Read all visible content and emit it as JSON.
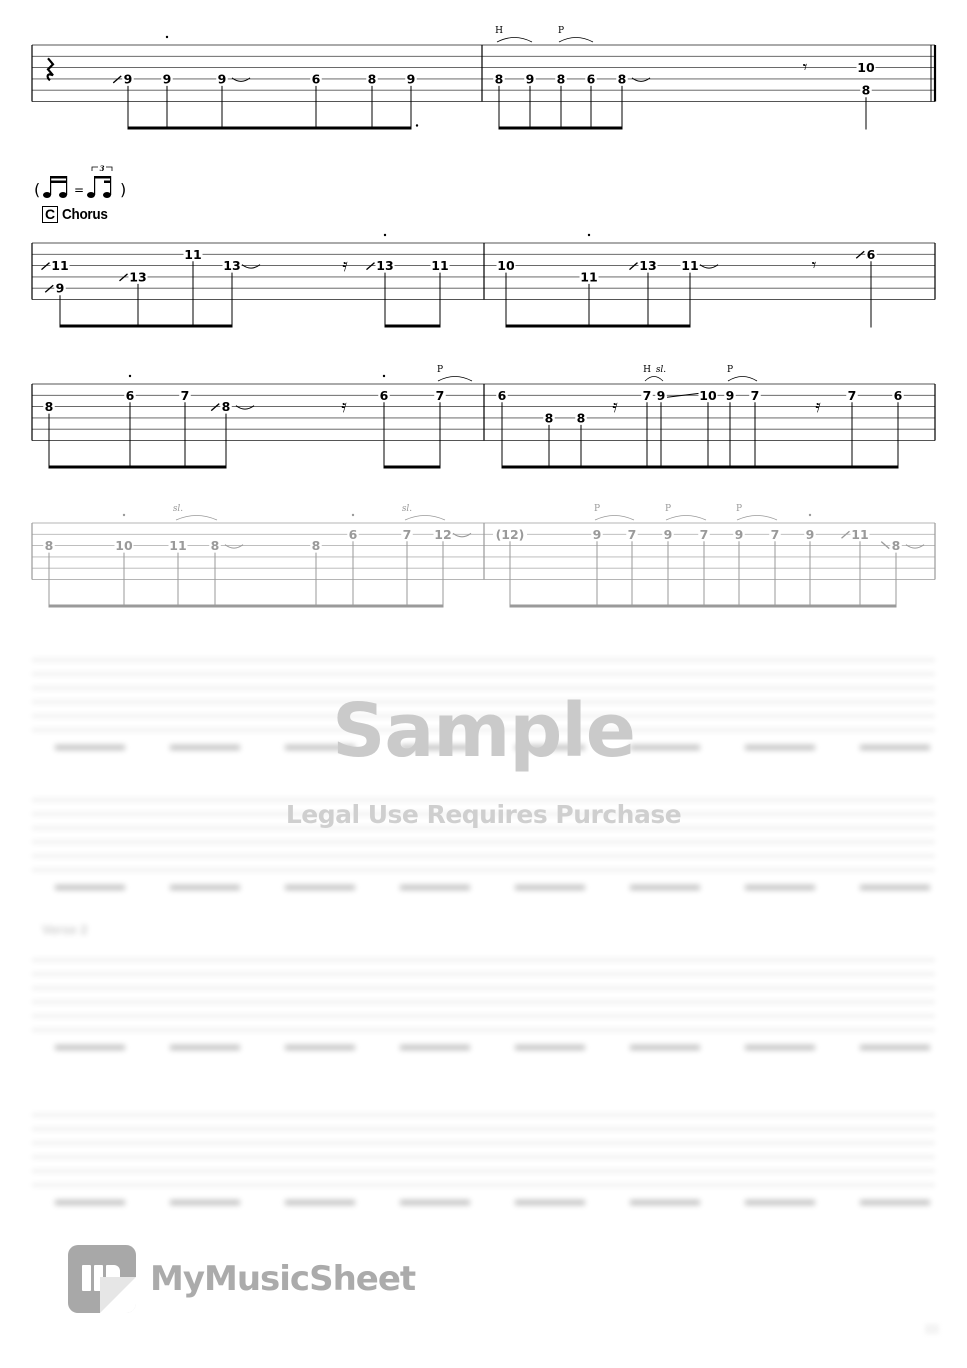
{
  "page": {
    "watermark": {
      "title": "Sample",
      "subtitle": "Legal Use Requires Purchase"
    },
    "brand": {
      "name": "MyMusicSheet"
    },
    "section_marker": {
      "letter": "C",
      "name": "Chorus"
    },
    "swing_note": {
      "left": "(",
      "equals": "=",
      "tuplet": "3",
      "right": ")"
    },
    "blurred_section_label": "Verse 2",
    "colors": {
      "ink": "#000000",
      "faded_ink": "#9a9a9a",
      "watermark": "#cacaca",
      "logo": "#a8a8a8"
    }
  },
  "systems": [
    {
      "id": "system-1",
      "faded": false,
      "end_barline": "double",
      "measures": [
        {
          "notes": [
            {
              "rest": "quarter"
            },
            {
              "string": 4,
              "fret": "9",
              "slide_in": "up",
              "beam": "16-8"
            },
            {
              "string": 4,
              "fret": "9",
              "dot_above": true
            },
            {
              "string": 4,
              "fret": "9",
              "tie_out": true
            },
            {
              "string": 4,
              "fret": "6"
            },
            {
              "string": 4,
              "fret": "8"
            },
            {
              "string": 4,
              "fret": "9",
              "dotted": true
            }
          ]
        },
        {
          "notes": [
            {
              "string": 4,
              "fret": "8",
              "technique": "H"
            },
            {
              "string": 4,
              "fret": "9"
            },
            {
              "string": 4,
              "fret": "8",
              "technique": "P"
            },
            {
              "string": 4,
              "fret": "6"
            },
            {
              "string": 4,
              "fret": "8",
              "tie_out": true
            },
            {
              "rest": "eighth"
            },
            {
              "chord": [
                {
                  "string": 3,
                  "fret": "10"
                },
                {
                  "string": 5,
                  "fret": "8"
                }
              ]
            }
          ]
        }
      ]
    },
    {
      "id": "system-2",
      "faded": false,
      "end_barline": "single",
      "measures": [
        {
          "notes": [
            {
              "chord": [
                {
                  "string": 3,
                  "fret": "11",
                  "slide_in": "up"
                },
                {
                  "string": 5,
                  "fret": "9",
                  "slide_in": "up"
                }
              ]
            },
            {
              "string": 4,
              "fret": "13",
              "slide_in": "up"
            },
            {
              "string": 2,
              "fret": "11"
            },
            {
              "string": 3,
              "fret": "13",
              "tie_out": true
            },
            {
              "rest": "sixteenth"
            },
            {
              "string": 3,
              "fret": "13",
              "slide_in": "up",
              "dot_above": true
            },
            {
              "string": 3,
              "fret": "11"
            }
          ]
        },
        {
          "notes": [
            {
              "string": 3,
              "fret": "10"
            },
            {
              "string": 4,
              "fret": "11",
              "dot_above": true
            },
            {
              "string": 3,
              "fret": "13",
              "slide_in": "up"
            },
            {
              "string": 3,
              "fret": "11",
              "tie_out": true
            },
            {
              "rest": "eighth"
            },
            {
              "string": 2,
              "fret": "6",
              "slide_in": "up"
            }
          ]
        }
      ]
    },
    {
      "id": "system-3",
      "faded": false,
      "end_barline": "single",
      "measures": [
        {
          "notes": [
            {
              "string": 3,
              "fret": "8"
            },
            {
              "string": 2,
              "fret": "6",
              "dot_above": true
            },
            {
              "string": 2,
              "fret": "7"
            },
            {
              "string": 3,
              "fret": "8",
              "slide_in": "up",
              "tie_out": true
            },
            {
              "rest": "sixteenth"
            },
            {
              "string": 2,
              "fret": "6",
              "dot_above": true
            },
            {
              "string": 2,
              "fret": "7",
              "technique": "P"
            }
          ]
        },
        {
          "notes": [
            {
              "string": 2,
              "fret": "6"
            },
            {
              "string": 4,
              "fret": "8"
            },
            {
              "string": 4,
              "fret": "8"
            },
            {
              "rest": "sixteenth"
            },
            {
              "string": 2,
              "fret": "7",
              "technique": "H"
            },
            {
              "string": 2,
              "fret": "9",
              "technique": "sl."
            },
            {
              "string": 2,
              "fret": "10"
            },
            {
              "string": 2,
              "fret": "9",
              "technique": "P"
            },
            {
              "string": 2,
              "fret": "7"
            },
            {
              "rest": "sixteenth"
            },
            {
              "string": 2,
              "fret": "7"
            },
            {
              "string": 2,
              "fret": "6"
            }
          ]
        }
      ]
    },
    {
      "id": "system-4",
      "faded": true,
      "end_barline": "single",
      "measures": [
        {
          "notes": [
            {
              "string": 3,
              "fret": "8"
            },
            {
              "string": 3,
              "fret": "10",
              "dot_above": true
            },
            {
              "string": 3,
              "fret": "11",
              "technique": "sl."
            },
            {
              "string": 3,
              "fret": "8",
              "tie_out": true
            },
            {
              "string": 3,
              "fret": "8"
            },
            {
              "string": 2,
              "fret": "6",
              "dot_above": true
            },
            {
              "string": 2,
              "fret": "7",
              "technique": "sl."
            },
            {
              "string": 2,
              "fret": "12",
              "tie_out": true
            }
          ]
        },
        {
          "notes": [
            {
              "string": 2,
              "fret": "(12)"
            },
            {
              "string": 2,
              "fret": "9",
              "technique": "P"
            },
            {
              "string": 2,
              "fret": "7"
            },
            {
              "string": 2,
              "fret": "9",
              "technique": "P"
            },
            {
              "string": 2,
              "fret": "7"
            },
            {
              "string": 2,
              "fret": "9",
              "technique": "P"
            },
            {
              "string": 2,
              "fret": "7"
            },
            {
              "string": 2,
              "fret": "9",
              "dot_above": true
            },
            {
              "string": 2,
              "fret": "11",
              "slide_in": "up"
            },
            {
              "string": 3,
              "fret": "8",
              "slide_in": "down",
              "tie_out": true
            }
          ]
        }
      ]
    }
  ]
}
